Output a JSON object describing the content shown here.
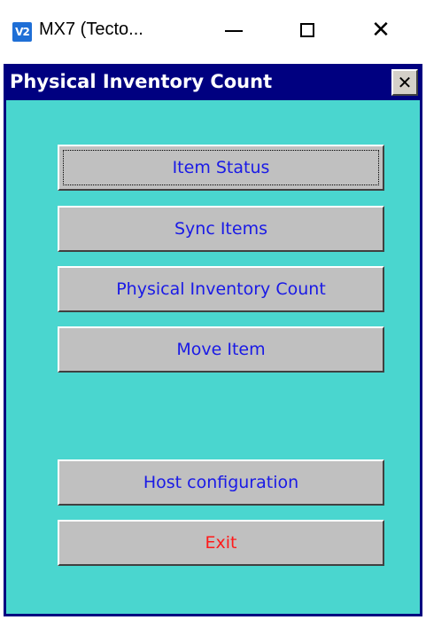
{
  "window": {
    "icon_text": "V2",
    "title": "MX7 (Tecto...",
    "minimize_glyph": "—",
    "close_glyph": "✕"
  },
  "app": {
    "title": "Physical Inventory Count",
    "close_glyph": "✕",
    "background_color": "#4ad6cf",
    "header_color": "#000080"
  },
  "menu": {
    "item_status": "Item Status",
    "sync_items": "Sync Items",
    "physical_inventory_count": "Physical Inventory Count",
    "move_item": "Move Item",
    "host_configuration": "Host configuration",
    "exit": "Exit",
    "text_color": "#1a1ae6",
    "exit_color": "#ff1a1a",
    "focused": "Item Status"
  }
}
